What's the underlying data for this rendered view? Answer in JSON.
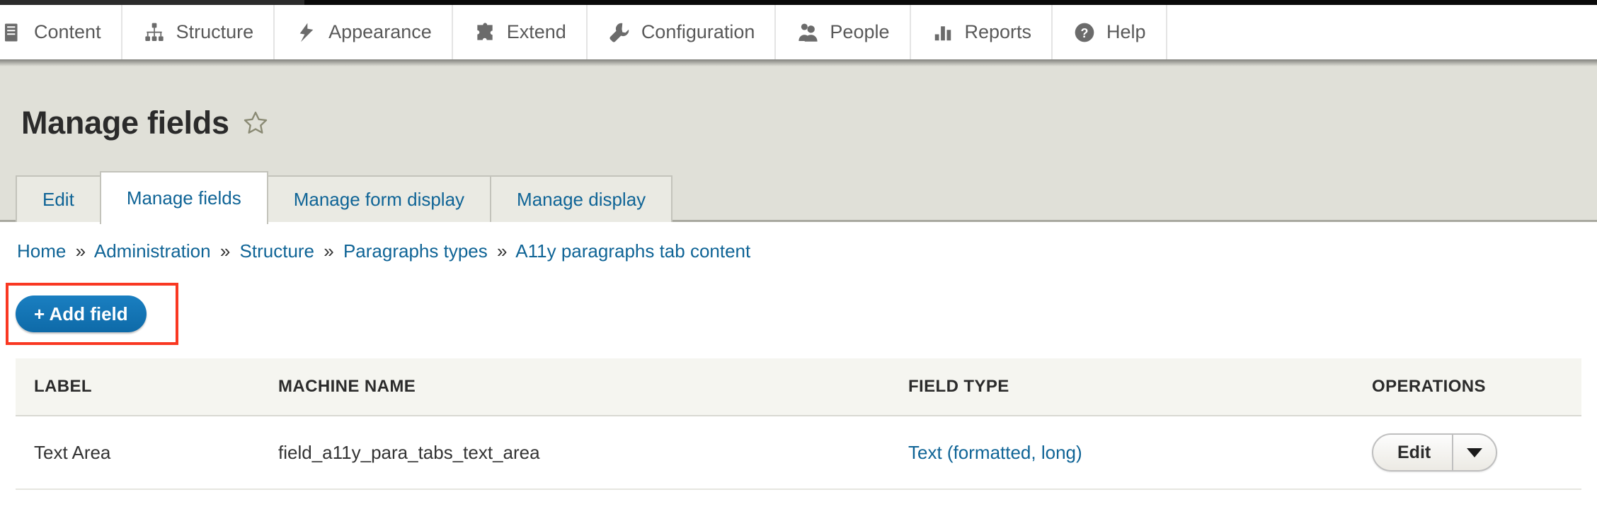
{
  "toolbar": {
    "items": [
      {
        "label": "Content",
        "icon": "content-icon"
      },
      {
        "label": "Structure",
        "icon": "structure-icon"
      },
      {
        "label": "Appearance",
        "icon": "appearance-icon"
      },
      {
        "label": "Extend",
        "icon": "extend-icon"
      },
      {
        "label": "Configuration",
        "icon": "configuration-icon"
      },
      {
        "label": "People",
        "icon": "people-icon"
      },
      {
        "label": "Reports",
        "icon": "reports-icon"
      },
      {
        "label": "Help",
        "icon": "help-icon"
      }
    ]
  },
  "header": {
    "title": "Manage fields",
    "star_icon": "star-outline-icon"
  },
  "tabs": [
    {
      "label": "Edit",
      "active": false
    },
    {
      "label": "Manage fields",
      "active": true
    },
    {
      "label": "Manage form display",
      "active": false
    },
    {
      "label": "Manage display",
      "active": false
    }
  ],
  "breadcrumb": {
    "separator": "»",
    "items": [
      "Home",
      "Administration",
      "Structure",
      "Paragraphs types",
      "A11y paragraphs tab content"
    ]
  },
  "actions": {
    "add_field_label": "+ Add field",
    "highlight_color": "#f93822",
    "button_color": "#0e6aa8"
  },
  "table": {
    "columns": [
      "LABEL",
      "MACHINE NAME",
      "FIELD TYPE",
      "OPERATIONS"
    ],
    "rows": [
      {
        "label": "Text Area",
        "machine_name": "field_a11y_para_tabs_text_area",
        "field_type": "Text (formatted, long)",
        "operation_label": "Edit",
        "operation_toggle_icon": "chevron-down-icon"
      }
    ]
  }
}
